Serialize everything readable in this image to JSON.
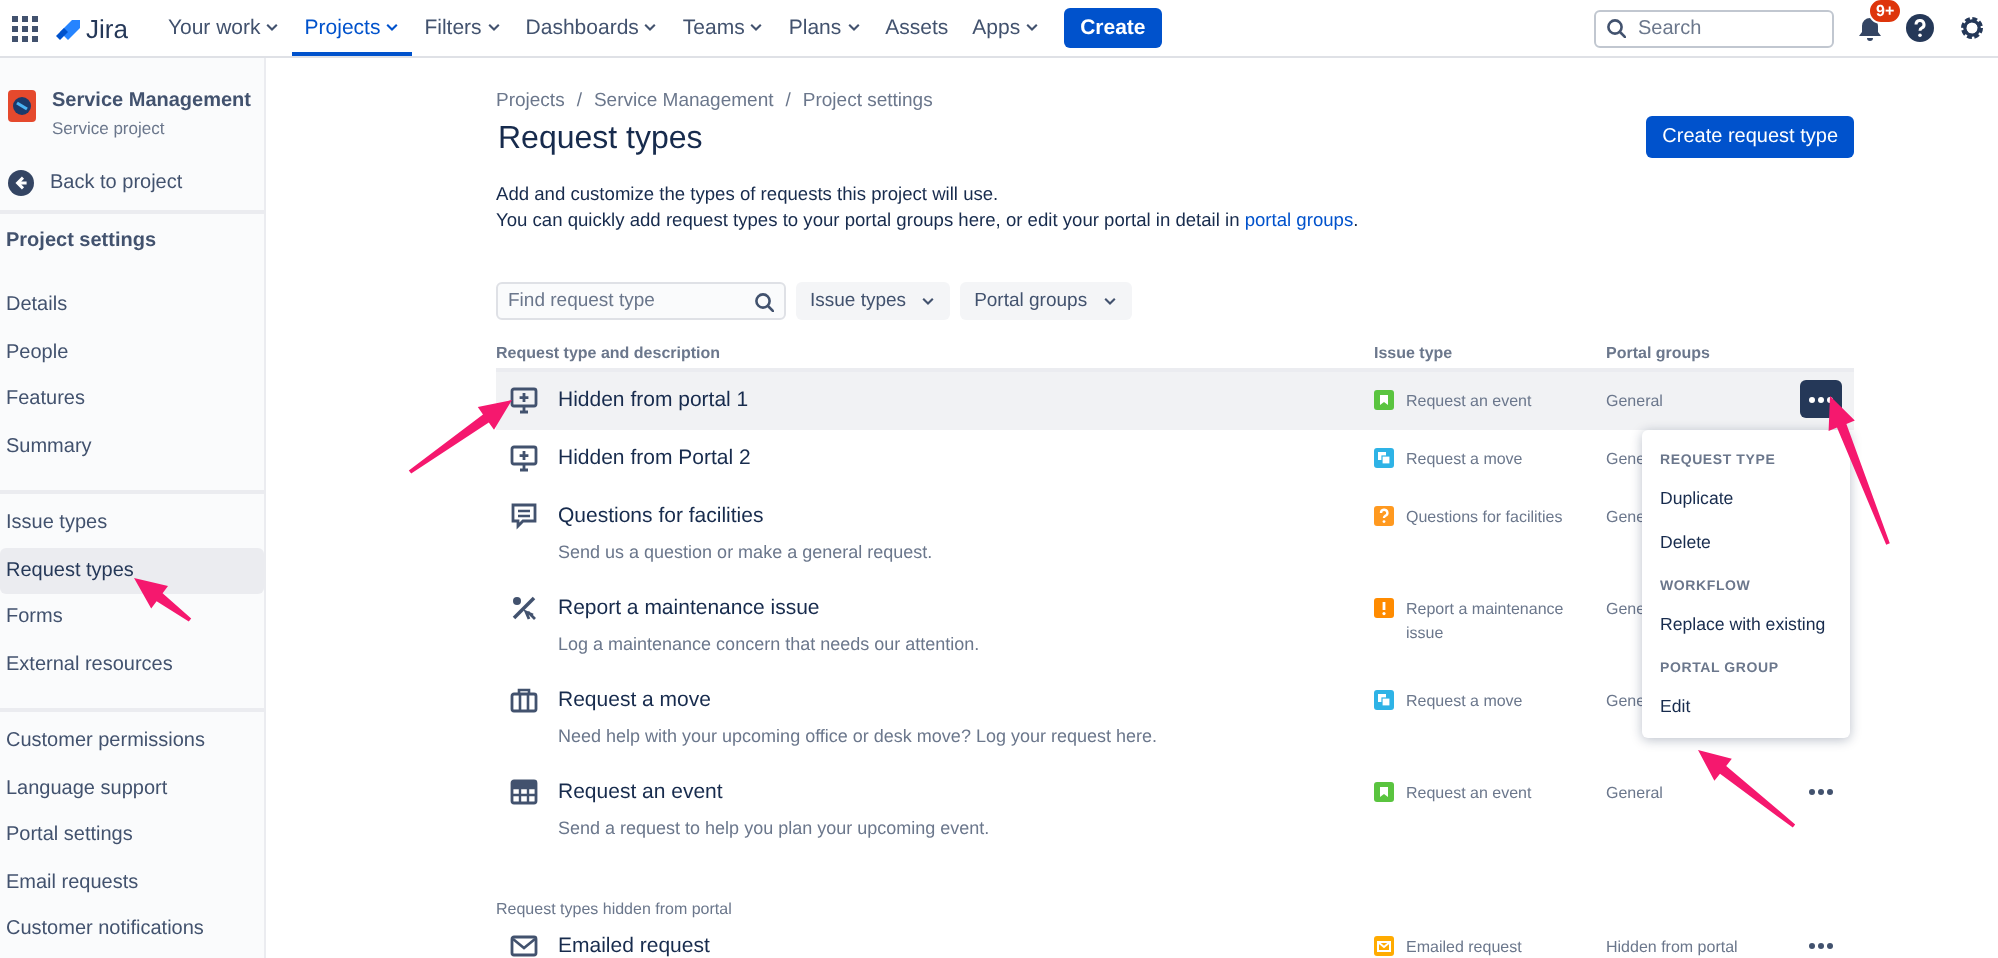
{
  "topbar": {
    "product": "Jira",
    "nav": [
      {
        "label": "Your work",
        "dropdown": true,
        "selected": false
      },
      {
        "label": "Projects",
        "dropdown": true,
        "selected": true
      },
      {
        "label": "Filters",
        "dropdown": true,
        "selected": false
      },
      {
        "label": "Dashboards",
        "dropdown": true,
        "selected": false
      },
      {
        "label": "Teams",
        "dropdown": true,
        "selected": false
      },
      {
        "label": "Plans",
        "dropdown": true,
        "selected": false
      },
      {
        "label": "Assets",
        "dropdown": false,
        "selected": false
      },
      {
        "label": "Apps",
        "dropdown": true,
        "selected": false
      }
    ],
    "create_button": "Create",
    "search": {
      "placeholder": "Search"
    },
    "notifications_badge": "9+"
  },
  "sidebar": {
    "project": {
      "name": "Service Management",
      "type": "Service project"
    },
    "back_link": "Back to project",
    "heading": "Project settings",
    "groups": [
      {
        "items": [
          {
            "label": "Details",
            "selected": false
          },
          {
            "label": "People",
            "selected": false
          },
          {
            "label": "Features",
            "selected": false
          },
          {
            "label": "Summary",
            "selected": false
          }
        ]
      },
      {
        "items": [
          {
            "label": "Issue types",
            "selected": false
          },
          {
            "label": "Request types",
            "selected": true
          },
          {
            "label": "Forms",
            "selected": false
          },
          {
            "label": "External resources",
            "selected": false
          }
        ]
      },
      {
        "items": [
          {
            "label": "Customer permissions",
            "selected": false
          },
          {
            "label": "Language support",
            "selected": false
          },
          {
            "label": "Portal settings",
            "selected": false
          },
          {
            "label": "Email requests",
            "selected": false
          },
          {
            "label": "Customer notifications",
            "selected": false
          }
        ]
      }
    ]
  },
  "page": {
    "breadcrumbs": [
      "Projects",
      "Service Management",
      "Project settings"
    ],
    "breadcrumb_separator": "/",
    "title": "Request types",
    "primary_button": "Create request type",
    "description": "Add and customize the types of requests this project will use.",
    "description_2": {
      "text": "You can quickly add request types to your portal groups here, or edit your portal in detail in ",
      "link": "portal groups",
      "after": "."
    },
    "filters": {
      "search_placeholder": "Find request type",
      "dropdowns": [
        "Issue types",
        "Portal groups"
      ]
    },
    "table": {
      "columns": [
        "Request type and description",
        "Issue type",
        "Portal groups"
      ],
      "rows": [
        {
          "kind": "monitor",
          "name": "Hidden from portal 1",
          "highlighted": true,
          "issue_type": {
            "kind": "event",
            "label": "Request an event",
            "color": "#5ac43f"
          },
          "portal_group": "General",
          "menu_button": {
            "active": true
          }
        },
        {
          "kind": "monitor",
          "name": "Hidden from Portal 2",
          "highlighted": false,
          "issue_type": {
            "kind": "move",
            "label": "Request a move",
            "color": "#2eb3e6"
          },
          "portal_group": "Gene"
        },
        {
          "kind": "comment",
          "name": "Questions for facilities",
          "description": "Send us a question or make a general request.",
          "highlighted": false,
          "issue_type": {
            "kind": "question",
            "label": "Questions for facilities",
            "color": "#ff991f"
          },
          "portal_group": "Gene"
        },
        {
          "kind": "tools",
          "name": "Report a maintenance issue",
          "description": "Log a maintenance concern that needs our attention.",
          "highlighted": false,
          "issue_type": {
            "kind": "alert",
            "label": "Report a maintenance issue",
            "color": "#ff8b00"
          },
          "portal_group": "Gene"
        },
        {
          "kind": "briefcase",
          "name": "Request a move",
          "description": "Need help with your upcoming office or desk move? Log your request here.",
          "highlighted": false,
          "issue_type": {
            "kind": "move",
            "label": "Request a move",
            "color": "#2eb3e6"
          },
          "portal_group": "Gene"
        },
        {
          "kind": "calendar",
          "name": "Request an event",
          "description": "Send a request to help you plan your upcoming event.",
          "highlighted": false,
          "issue_type": {
            "kind": "event",
            "label": "Request an event",
            "color": "#5ac43f"
          },
          "portal_group": "General",
          "menu_button": {
            "active": false
          }
        }
      ]
    },
    "hidden_section": {
      "label": "Request types hidden from portal",
      "rows": [
        {
          "kind": "mail",
          "name": "Emailed request",
          "highlighted": false,
          "issue_type": {
            "kind": "mail",
            "label": "Emailed request",
            "color": "#ffab00"
          },
          "portal_group": "Hidden from portal",
          "menu_button": {
            "active": false
          }
        }
      ]
    },
    "menu": {
      "sections": [
        {
          "heading": "REQUEST TYPE",
          "items": [
            "Duplicate",
            "Delete"
          ]
        },
        {
          "heading": "WORKFLOW",
          "items": [
            "Replace with existing"
          ]
        },
        {
          "heading": "PORTAL GROUP",
          "items": [
            "Edit"
          ]
        }
      ]
    }
  },
  "annotations": [
    {
      "kind": "arrow"
    },
    {
      "kind": "arrow"
    },
    {
      "kind": "arrow"
    },
    {
      "kind": "arrow"
    }
  ]
}
